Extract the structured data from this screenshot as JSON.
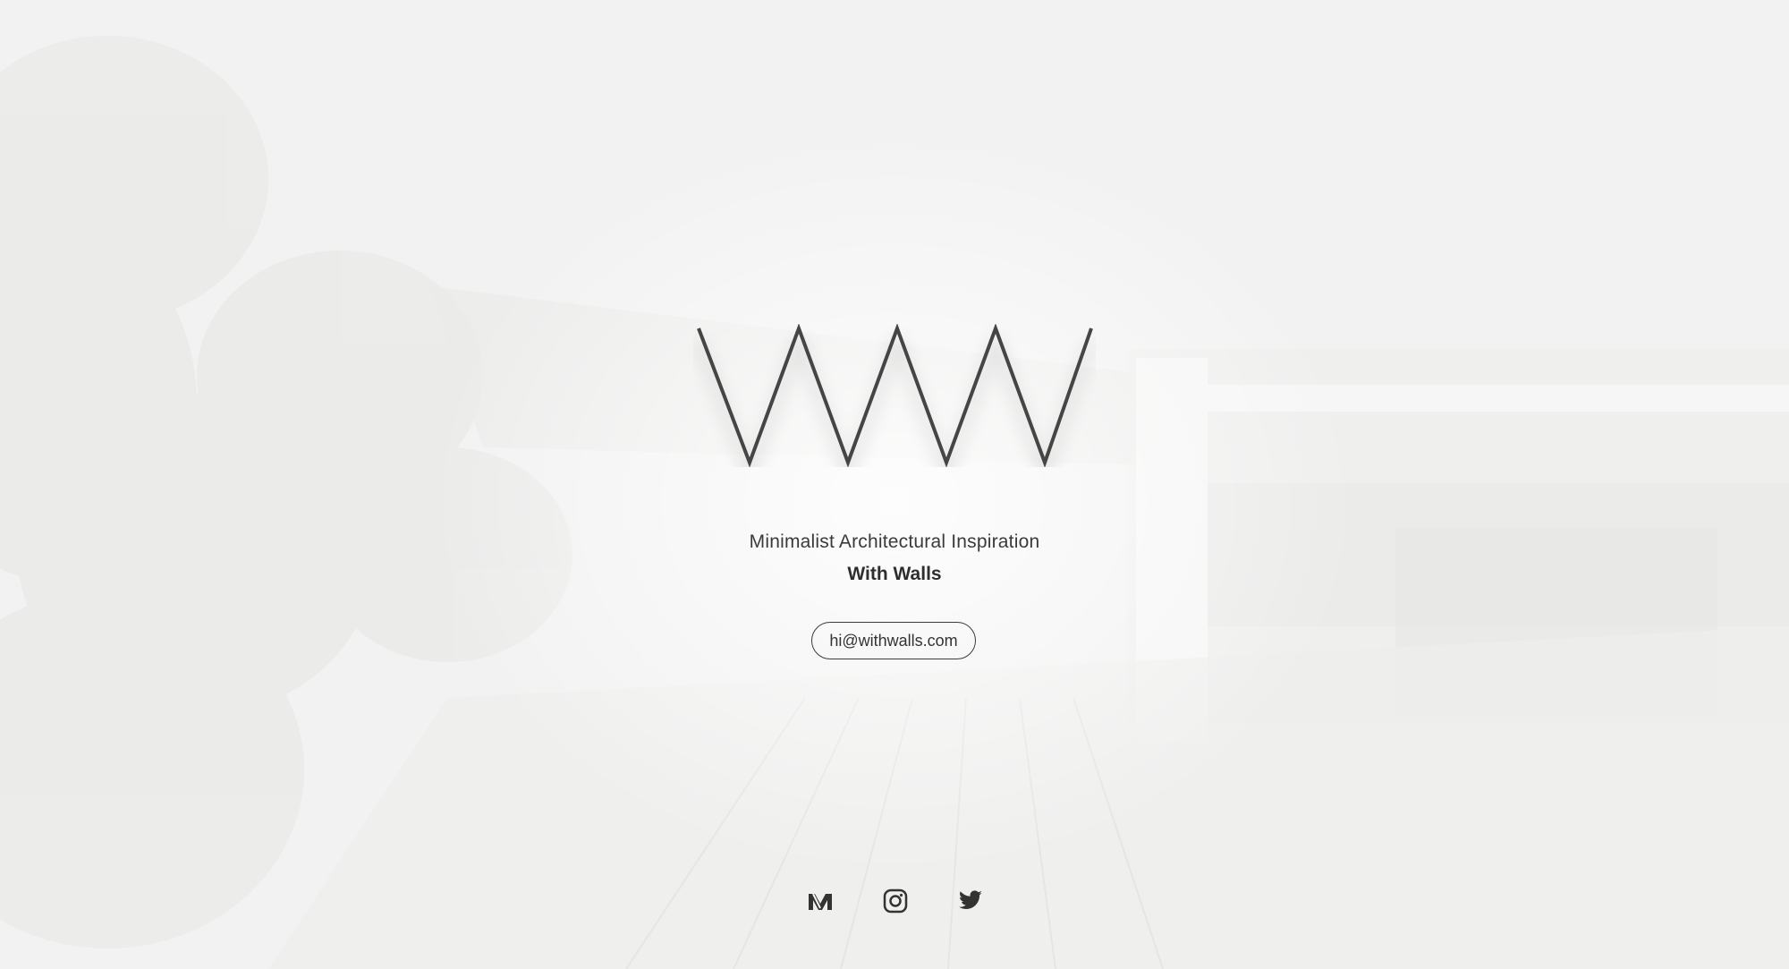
{
  "hero": {
    "tagline": "Minimalist Architectural Inspiration",
    "brand": "With Walls",
    "email": "hi@withwalls.com"
  },
  "social": {
    "items": [
      {
        "name": "Medium",
        "icon": "medium-icon"
      },
      {
        "name": "Instagram",
        "icon": "instagram-icon"
      },
      {
        "name": "Twitter",
        "icon": "twitter-icon"
      }
    ]
  },
  "colors": {
    "background": "#f3f3f3",
    "logo_stroke": "#444444",
    "text": "#333333"
  }
}
